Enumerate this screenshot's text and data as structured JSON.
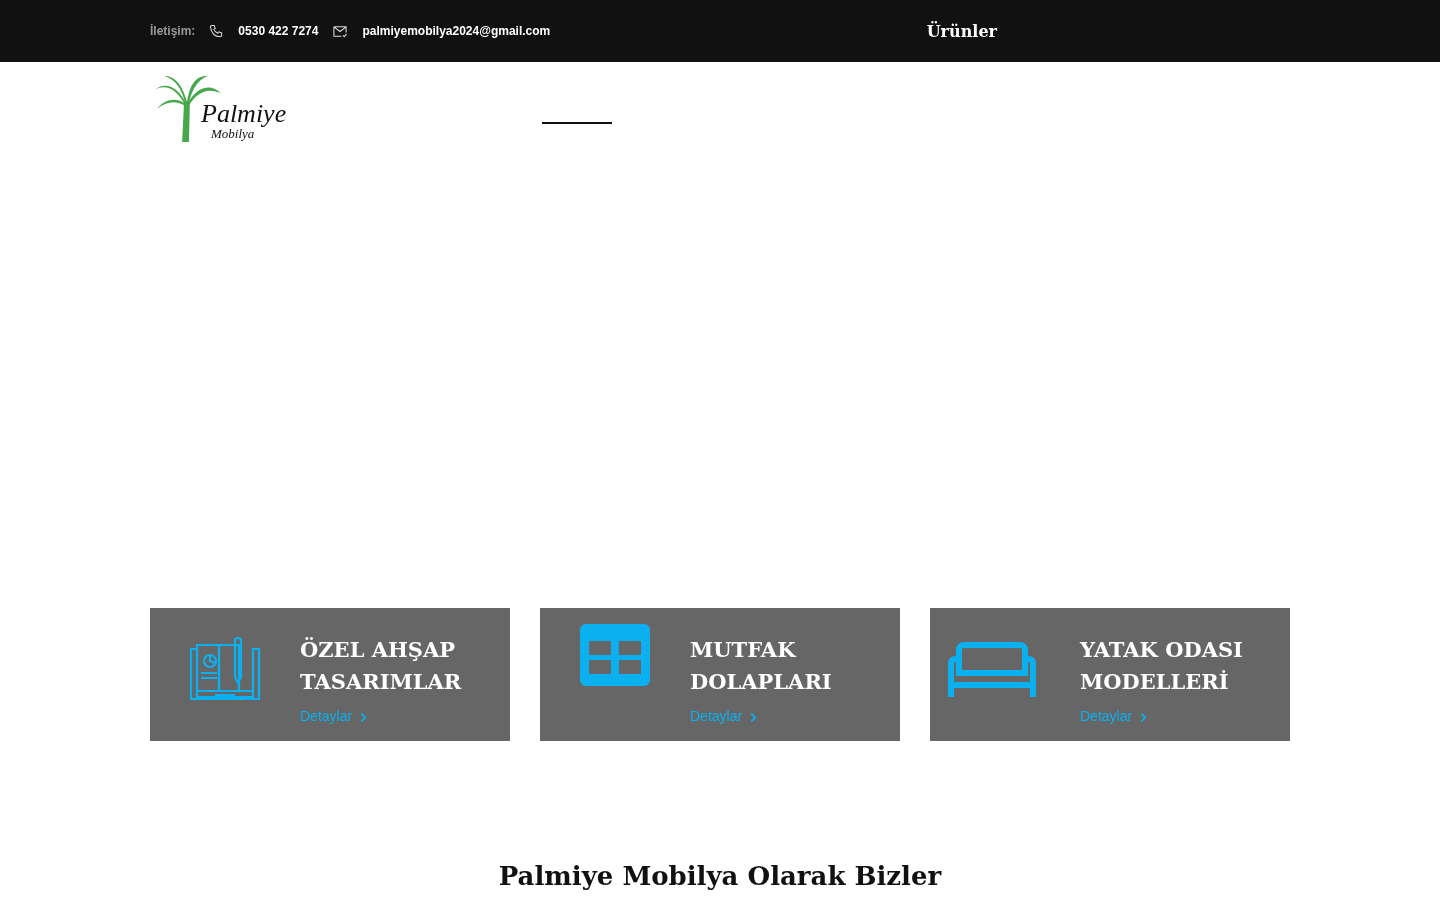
{
  "topbar": {
    "contact_label": "İletişim:",
    "phone": "0530 422 7274",
    "email": "palmiyemobilya2024@gmail.com",
    "link": "Ürünler"
  },
  "logo": {
    "name": "Palmiye",
    "sub": "Mobilya"
  },
  "features": [
    {
      "kind": "book",
      "title": "ÖZEL AHŞAP TASARIMLAR",
      "link": "Detaylar"
    },
    {
      "kind": "grid",
      "title": "MUTFAK DOLAPLARI",
      "link": "Detaylar"
    },
    {
      "kind": "sofa",
      "title": "YATAK ODASI MODELLERİ",
      "link": "Detaylar"
    }
  ],
  "section_title": "Palmiye Mobilya Olarak Bizler"
}
